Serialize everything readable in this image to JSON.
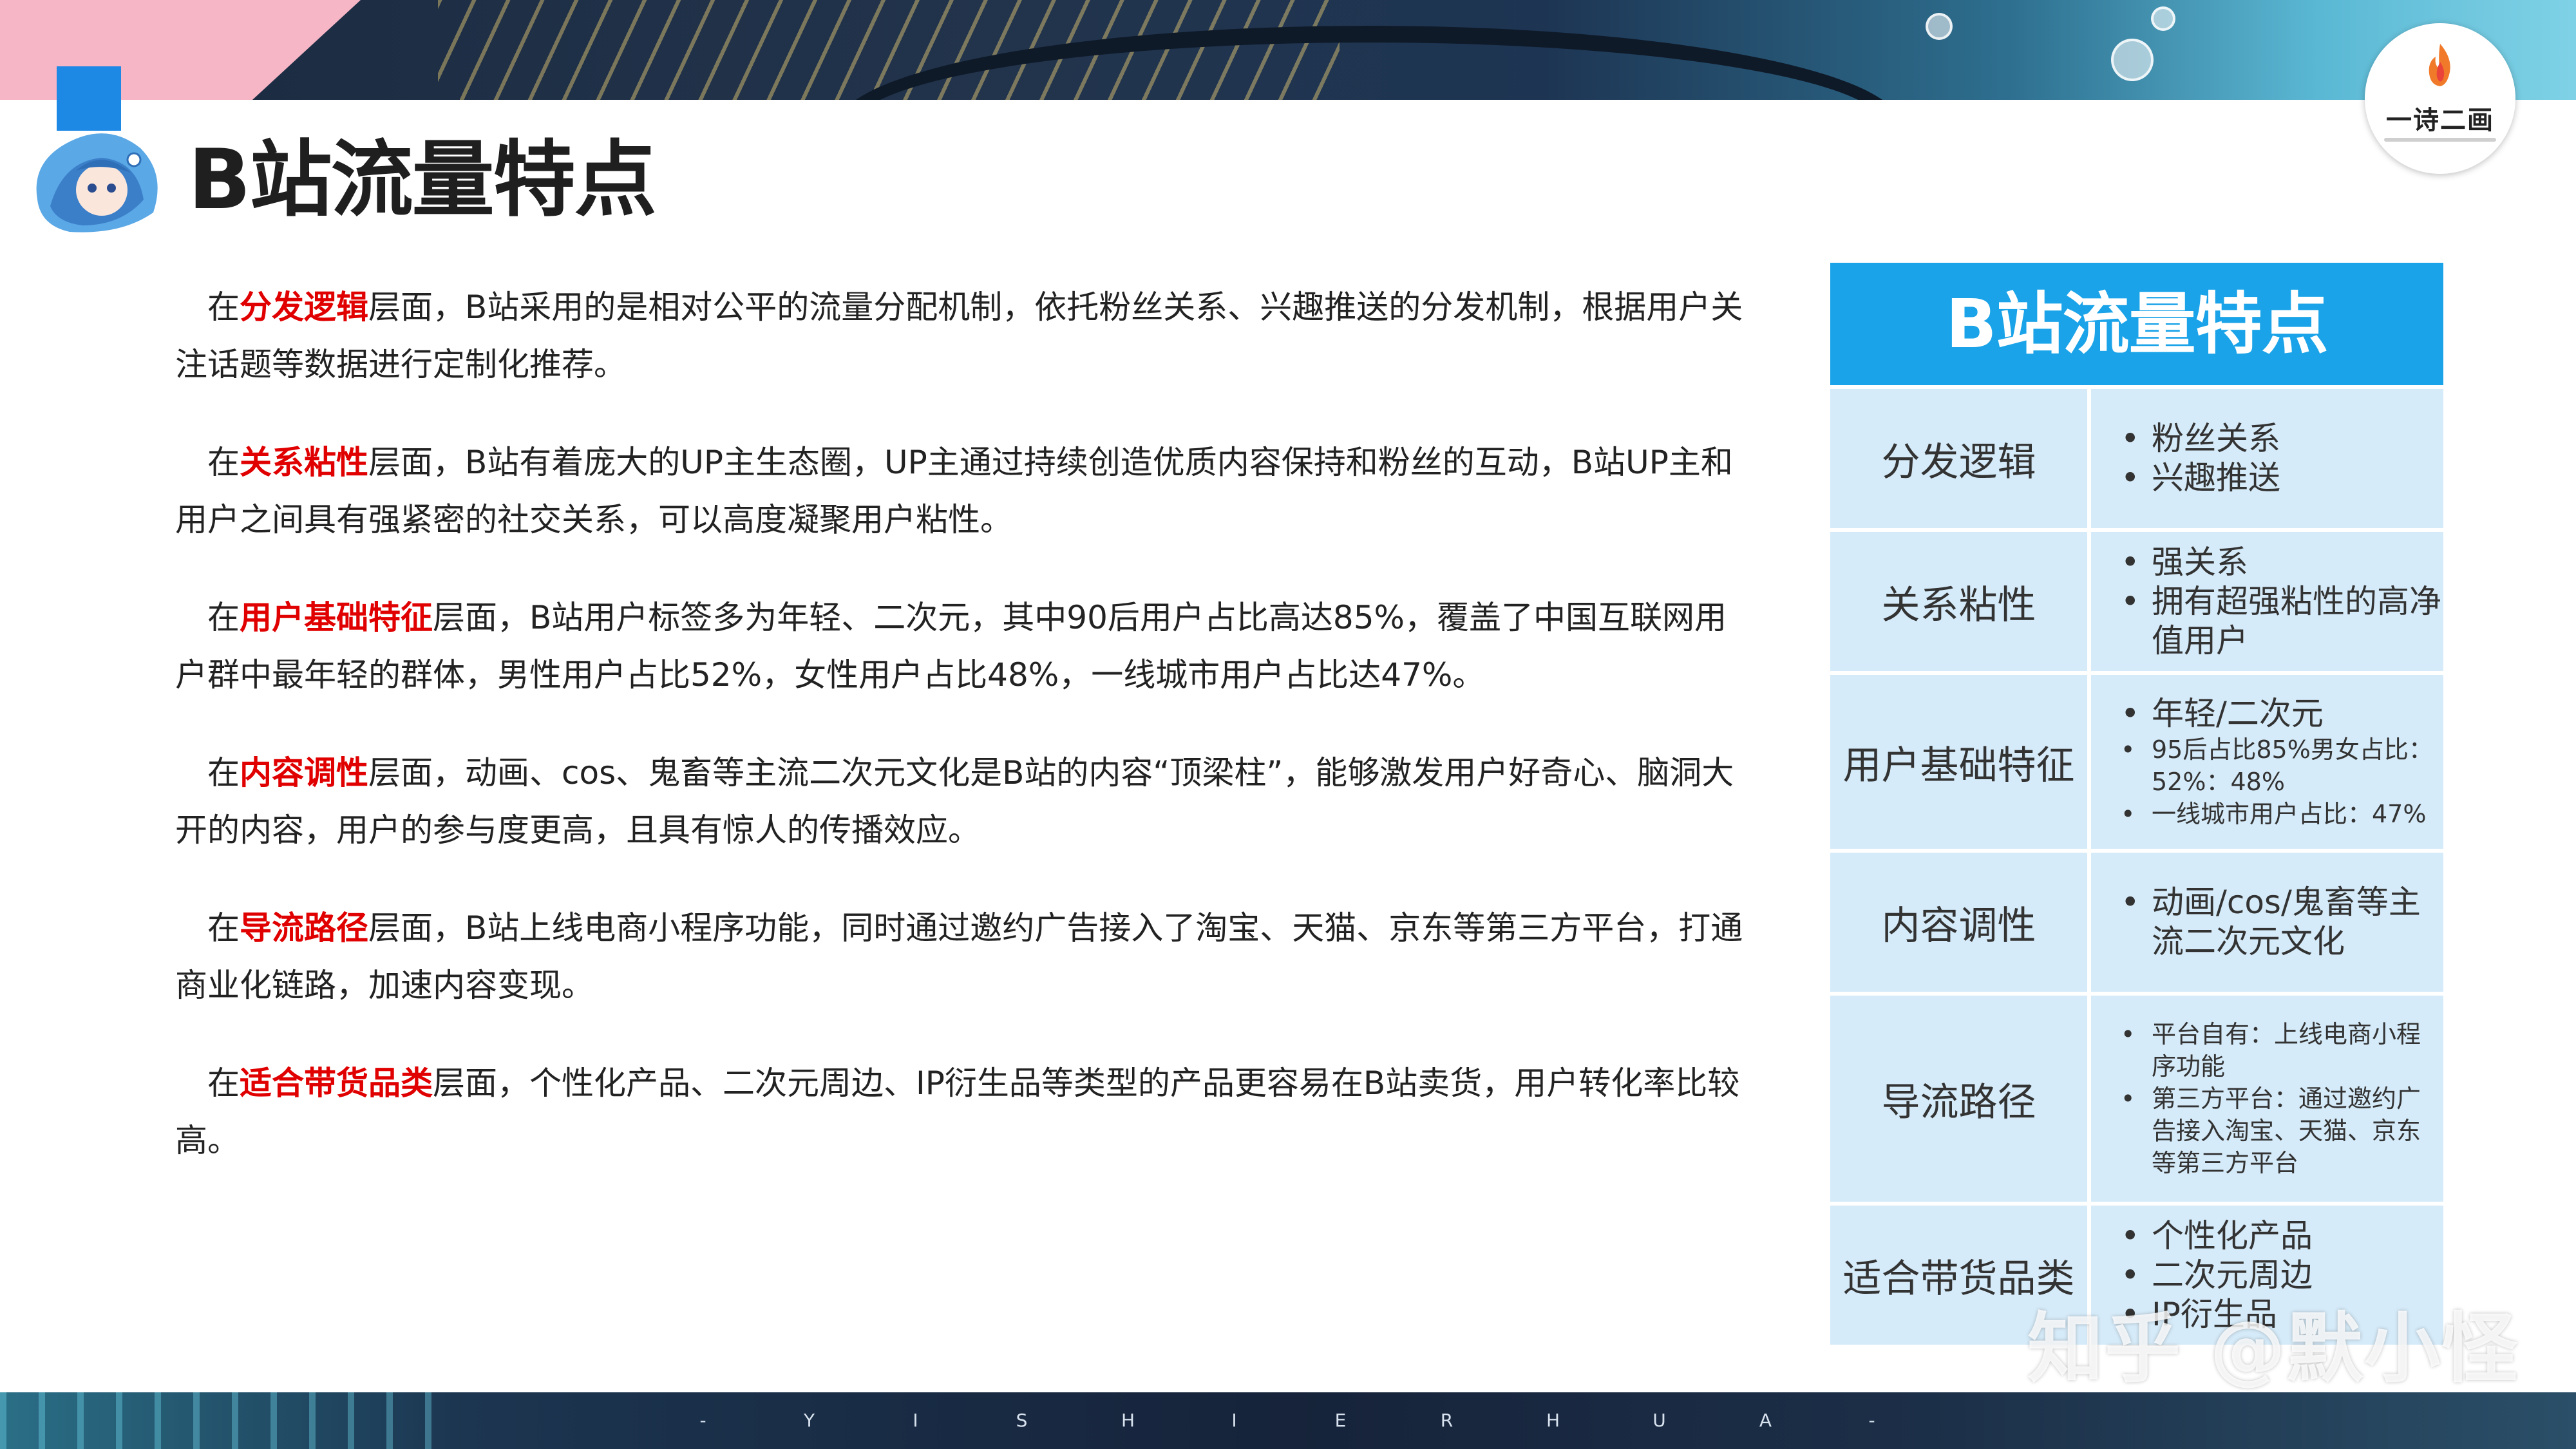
{
  "title": "B站流量特点",
  "logo": {
    "text": "一诗二画"
  },
  "paragraphs": [
    {
      "pre": "在",
      "keyword": "分发逻辑",
      "post": "层面，B站采用的是相对公平的流量分配机制，依托粉丝关系、兴趣推送的分发机制，根据用户关注话题等数据进行定制化推荐。"
    },
    {
      "pre": "在",
      "keyword": "关系粘性",
      "post": "层面，B站有着庞大的UP主生态圈，UP主通过持续创造优质内容保持和粉丝的互动，B站UP主和用户之间具有强紧密的社交关系，可以高度凝聚用户粘性。"
    },
    {
      "pre": "在",
      "keyword": "用户基础特征",
      "post": "层面，B站用户标签多为年轻、二次元，其中90后用户占比高达85%，覆盖了中国互联网用户群中最年轻的群体，男性用户占比52%，女性用户占比48%，一线城市用户占比达47%。"
    },
    {
      "pre": "在",
      "keyword": "内容调性",
      "post": "层面，动画、cos、鬼畜等主流二次元文化是B站的内容“顶梁柱”，能够激发用户好奇心、脑洞大开的内容，用户的参与度更高，且具有惊人的传播效应。"
    },
    {
      "pre": "在",
      "keyword": "导流路径",
      "post": "层面，B站上线电商小程序功能，同时通过邀约广告接入了淘宝、天猫、京东等第三方平台，打通商业化链路，加速内容变现。"
    },
    {
      "pre": "在",
      "keyword": "适合带货品类",
      "post": "层面，个性化产品、二次元周边、IP衍生品等类型的产品更容易在B站卖货，用户转化率比较高。"
    }
  ],
  "summary": {
    "header": "B站流量特点",
    "rows": [
      {
        "label": "分发逻辑",
        "items": [
          "粉丝关系",
          "兴趣推送"
        ]
      },
      {
        "label": "关系粘性",
        "items": [
          "强关系",
          "拥有超强粘性的高净值用户"
        ]
      },
      {
        "label": "用户基础特征",
        "items": [
          "年轻/二次元",
          "95后占比85%男女占比：52%：48%",
          "一线城市用户占比：47%"
        ]
      },
      {
        "label": "内容调性",
        "items": [
          "动画/cos/鬼畜等主流二次元文化"
        ]
      },
      {
        "label": "导流路径",
        "items": [
          "平台自有：上线电商小程序功能",
          "第三方平台：通过邀约广告接入淘宝、天猫、京东等第三方平台"
        ]
      },
      {
        "label": "适合带货品类",
        "items": [
          "个性化产品",
          "二次元周边",
          "IP衍生品"
        ]
      }
    ]
  },
  "footer": {
    "letters": [
      "-",
      "Y",
      "I",
      "S",
      "H",
      "I",
      "E",
      "R",
      "H",
      "U",
      "A",
      "-"
    ]
  },
  "watermark": "知乎 @默小怪",
  "colors": {
    "keyword": "#e00000",
    "header": "#1aa3e8",
    "cell": "#d6ebf9"
  }
}
